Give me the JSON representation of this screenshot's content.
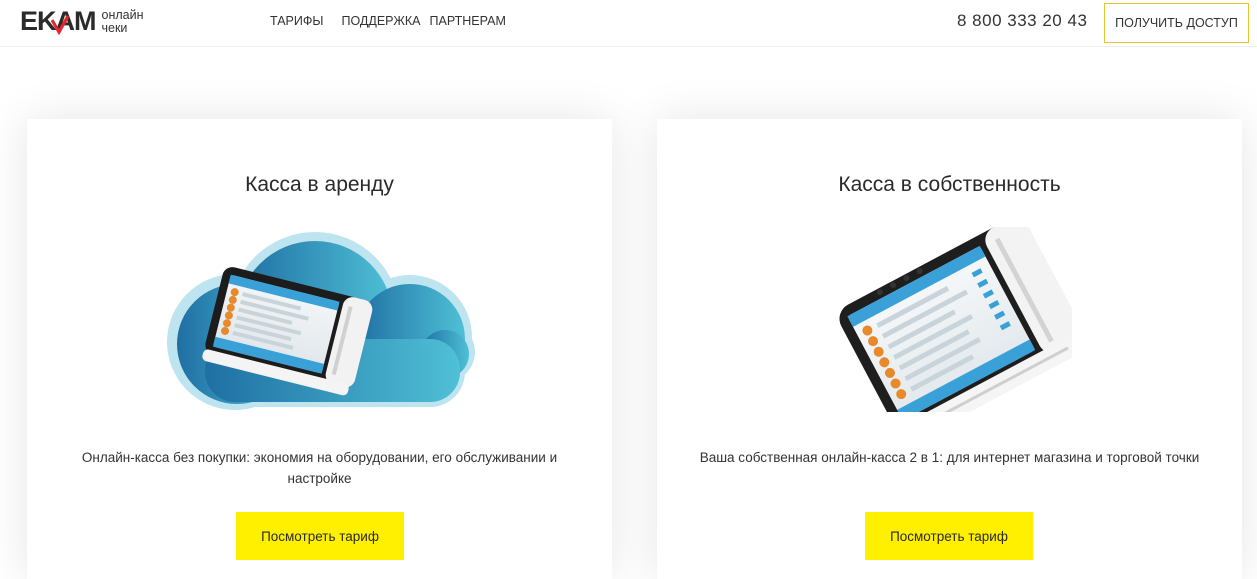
{
  "header": {
    "logo_text": "EKAM",
    "logo_sub_line1": "онлайн",
    "logo_sub_line2": "чеки",
    "nav": [
      "ТАРИФЫ",
      "ПОДДЕРЖКА",
      "ПАРТНЕРАМ"
    ],
    "phone": "8 800 333 20 43",
    "cta_label": "ПОЛУЧИТЬ ДОСТУП"
  },
  "cards": [
    {
      "title": "Касса в аренду",
      "description": "Онлайн-касса без покупки: экономия на оборудовании, его обслуживании и настройке",
      "button_label": "Посмотреть тариф",
      "illustration": "terminal-on-cloud"
    },
    {
      "title": "Касса в собственность",
      "description": "Ваша собственная онлайн-касса 2 в 1: для интернет магазина и торговой точки",
      "button_label": "Посмотреть тариф",
      "illustration": "terminal"
    }
  ],
  "colors": {
    "accent_yellow": "#fff000",
    "cta_border": "#e3c72e",
    "logo_tick": "#e5262c",
    "cloud_blue": "#2a8fc0"
  }
}
